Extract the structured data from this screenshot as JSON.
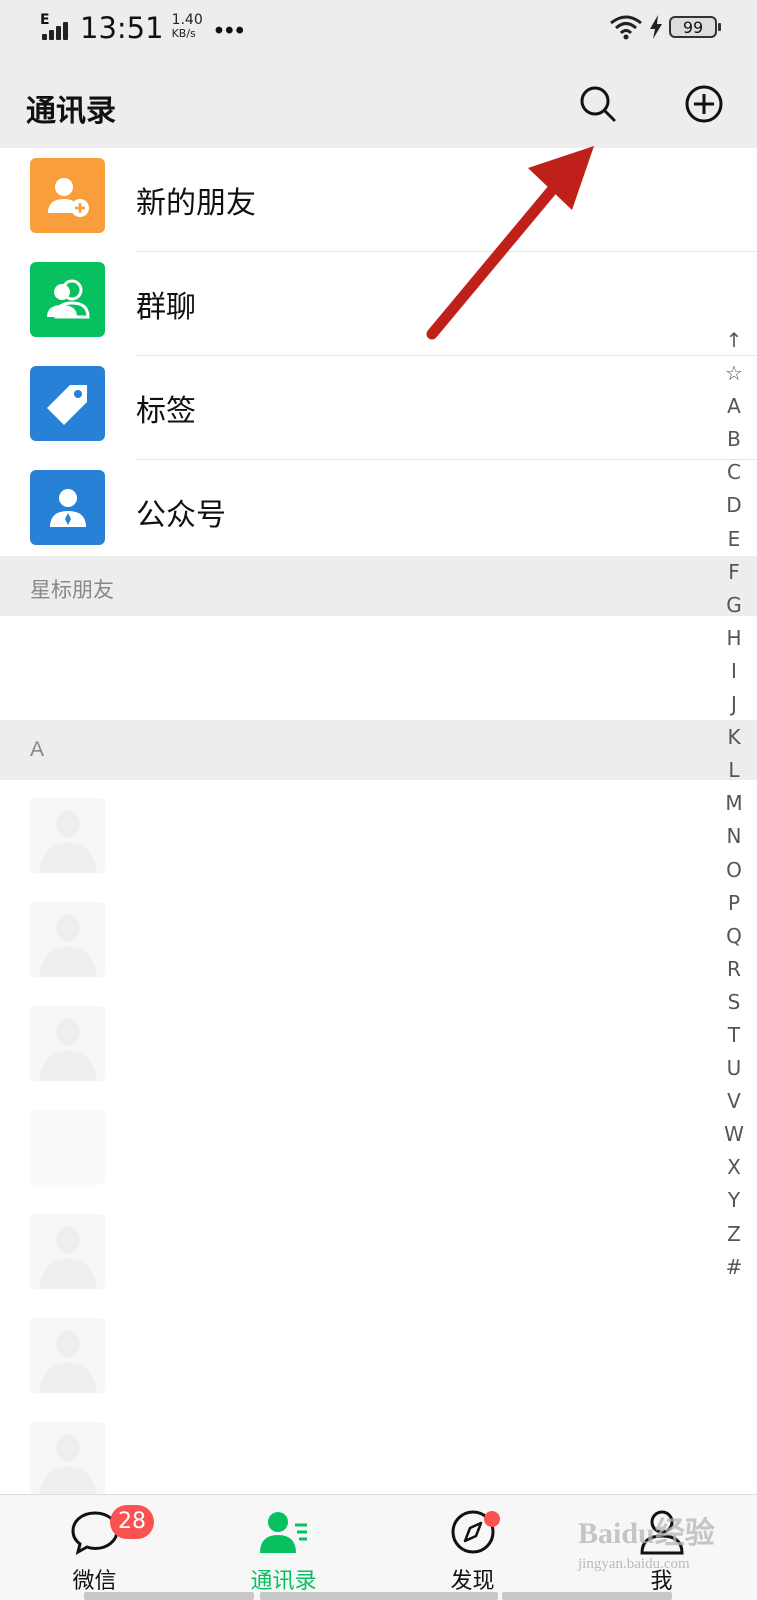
{
  "status_bar": {
    "network": "E",
    "time": "13:51",
    "speed_value": "1.40",
    "speed_unit": "KB/s",
    "more": "•••",
    "battery": "99"
  },
  "header": {
    "title": "通讯录",
    "icons": [
      "search-icon",
      "add-circle-icon"
    ]
  },
  "functions": [
    {
      "label": "新的朋友",
      "icon": "add-friend-icon",
      "color": "#fa9d3b"
    },
    {
      "label": "群聊",
      "icon": "group-icon",
      "color": "#07c160"
    },
    {
      "label": "标签",
      "icon": "tag-icon",
      "color": "#2782d7"
    },
    {
      "label": "公众号",
      "icon": "official-account-icon",
      "color": "#2782d7"
    }
  ],
  "sections": {
    "starred": "星标朋友",
    "letter_a": "A"
  },
  "index_letters": [
    "↑",
    "☆",
    "A",
    "B",
    "C",
    "D",
    "E",
    "F",
    "G",
    "H",
    "I",
    "J",
    "K",
    "L",
    "M",
    "N",
    "O",
    "P",
    "Q",
    "R",
    "S",
    "T",
    "U",
    "V",
    "W",
    "X",
    "Y",
    "Z",
    "#"
  ],
  "tabs": [
    {
      "label": "微信",
      "icon": "chat-icon",
      "badge": "28"
    },
    {
      "label": "通讯录",
      "icon": "contacts-icon",
      "active": true
    },
    {
      "label": "发现",
      "icon": "compass-icon",
      "dot": true
    },
    {
      "label": "我",
      "icon": "person-icon"
    }
  ],
  "accent_color": "#07c160",
  "annotation_arrow_color": "#c0201a",
  "watermark": {
    "brand": "Baidu经验",
    "url": "jingyan.baidu.com"
  }
}
